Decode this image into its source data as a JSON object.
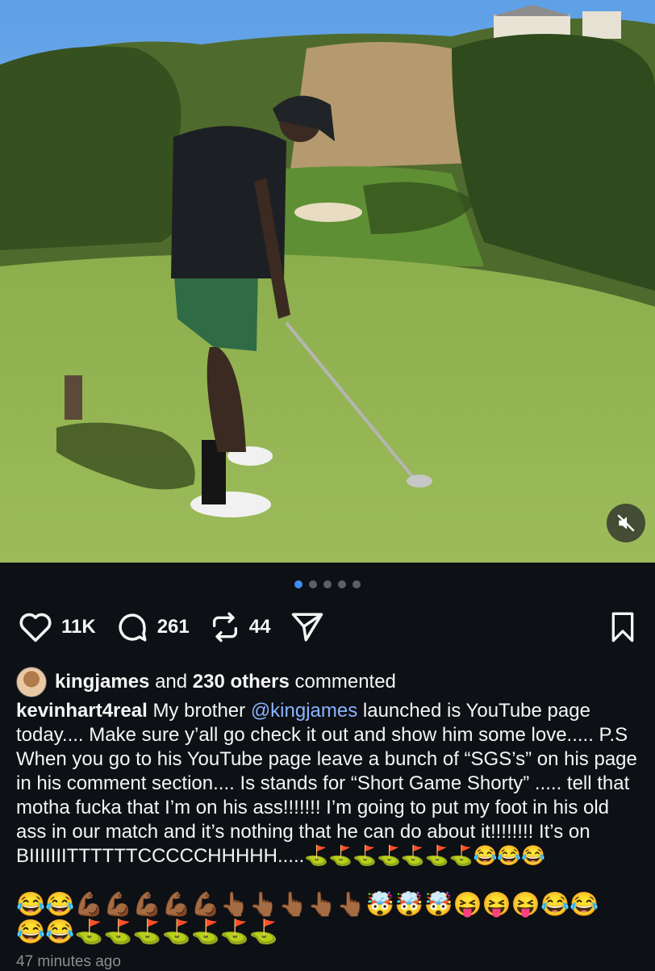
{
  "post": {
    "media": {
      "slide_count": 5,
      "active_slide": 1,
      "muted": true
    },
    "icons": {
      "like": "heart-icon",
      "comment": "comment-bubble-icon",
      "repost": "repost-icon",
      "share": "send-icon",
      "save": "bookmark-icon",
      "mute": "speaker-muted-icon"
    },
    "likes": "11K",
    "comments": "261",
    "reposts": "44",
    "commented_by": {
      "user": "kingjames",
      "and_text": "and",
      "others": "230 others",
      "suffix": "commented"
    },
    "caption": {
      "author": "kevinhart4real",
      "text_before": "My brother ",
      "mention": "@kingjames",
      "text_after": " launched is YouTube page today.... Make sure y’all go check it out and show him some love..... P.S When you go to his YouTube page leave a bunch of “SGS’s” on his page in his comment section.... Is stands for “Short Game Shorty” ..... tell that motha fucka that I’m on his ass!!!!!!! I’m going to put my foot in his old ass in our match and it’s nothing that he can do about it!!!!!!!! It’s on BIIIIIIITTTTTTCCCCCHHHHH.....⛳⛳⛳⛳⛳⛳⛳😂😂😂"
    },
    "emoji_lines": [
      "😂😂💪🏾💪🏾💪🏾💪🏾💪🏾👆🏾👆🏾👆🏾👆🏾👆🏾🤯🤯🤯😝😝😝😂😂",
      "😂😂⛳⛳⛳⛳⛳⛳⛳"
    ],
    "timestamp": "47 minutes ago"
  },
  "colors": {
    "accent": "#3e8cf0",
    "background": "#0d1014",
    "mention": "#8ab4ff"
  }
}
